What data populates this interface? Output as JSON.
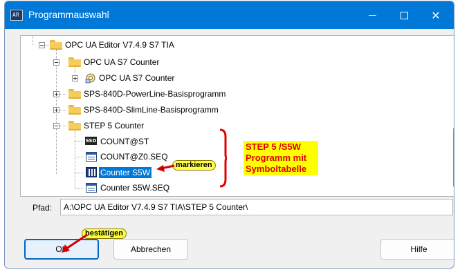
{
  "window": {
    "title": "Programmauswahl",
    "app_icon_text": "AR",
    "controls": {
      "minimize": "minimize",
      "maximize": "maximize",
      "close": "✕"
    }
  },
  "tree": {
    "nodes": [
      {
        "label": "OPC UA Editor V7.4.9 S7 TIA",
        "icon": "folder-open-icon",
        "expander": "minus"
      },
      {
        "label": "OPC UA S7 Counter",
        "icon": "folder-open-icon",
        "expander": "minus"
      },
      {
        "label": "OPC UA S7 Counter",
        "icon": "opc-project-icon",
        "expander": "plus"
      },
      {
        "label": "SPS-840D-PowerLine-Basisprogramm",
        "icon": "folder-icon",
        "expander": "plus"
      },
      {
        "label": "SPS-840D-SlimLine-Basisprogramm",
        "icon": "folder-icon",
        "expander": "plus"
      },
      {
        "label": "STEP 5 Counter",
        "icon": "folder-open-icon",
        "expander": "minus"
      },
      {
        "label": "COUNT@ST",
        "icon": "ssd-file-icon"
      },
      {
        "label": "COUNT@Z0.SEQ",
        "icon": "seq-file-icon"
      },
      {
        "label": "Counter S5W",
        "icon": "s5w-file-icon",
        "selected": true
      },
      {
        "label": "Counter S5W.SEQ",
        "icon": "seq-file-icon"
      }
    ],
    "ssd_icon_text": "SSD"
  },
  "annotations": {
    "markieren": "markieren",
    "bestaetigen": "bestätigen",
    "note_lines": [
      "STEP 5 /S5W",
      "Programm mit",
      "Symboltabelle"
    ],
    "note_color": "#e00000",
    "highlight_color": "#ffff00"
  },
  "path": {
    "label": "Pfad:",
    "value": "A:\\OPC UA Editor V7.4.9 S7 TIA\\STEP 5 Counter\\"
  },
  "buttons": {
    "ok": "OK",
    "cancel": "Abbrechen",
    "help": "Hilfe"
  },
  "colors": {
    "titlebar": "#0078d7",
    "selection": "#0078d7",
    "ok_border": "#0067c0"
  }
}
